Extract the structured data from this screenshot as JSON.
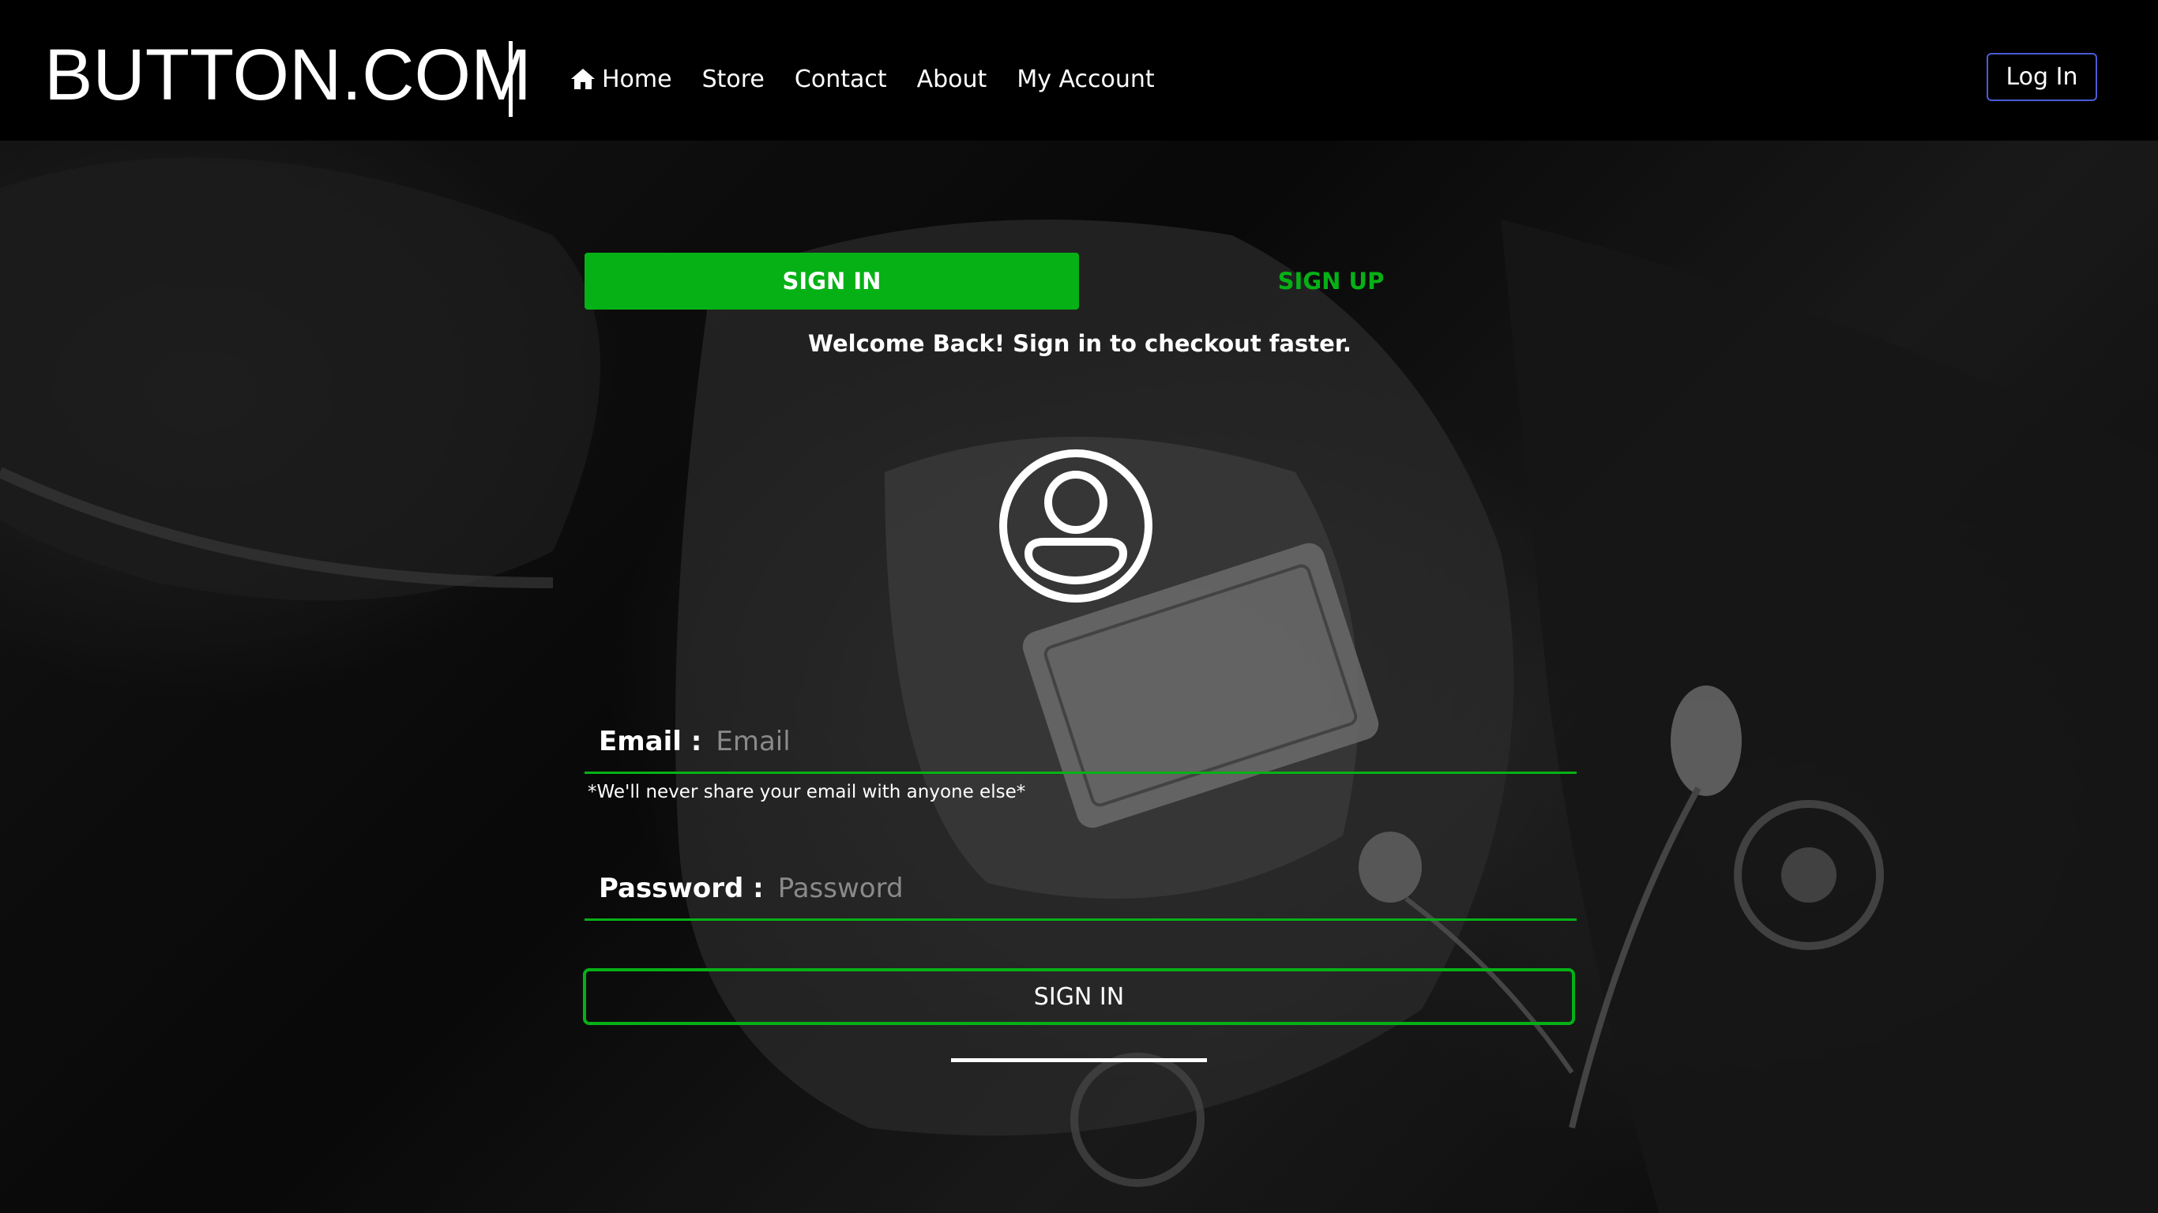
{
  "navbar": {
    "brand": "BUTTON.COM",
    "links": [
      {
        "label": "Home",
        "icon": "home-icon"
      },
      {
        "label": "Store"
      },
      {
        "label": "Contact"
      },
      {
        "label": "About"
      },
      {
        "label": "My Account"
      }
    ],
    "login_label": "Log In"
  },
  "auth": {
    "tab_signin": "SIGN IN",
    "tab_signup": "SIGN UP",
    "welcome": "Welcome Back! Sign in to checkout faster.",
    "avatar_icon": "user-circle-icon",
    "email_label": "Email :",
    "email_placeholder": "Email",
    "email_note": "*We'll never share your email with anyone else*",
    "password_label": "Password :",
    "password_placeholder": "Password",
    "submit_label": "SIGN IN"
  },
  "colors": {
    "accent_green": "#06b116",
    "login_border": "#4a5bd8",
    "background": "#000000"
  }
}
